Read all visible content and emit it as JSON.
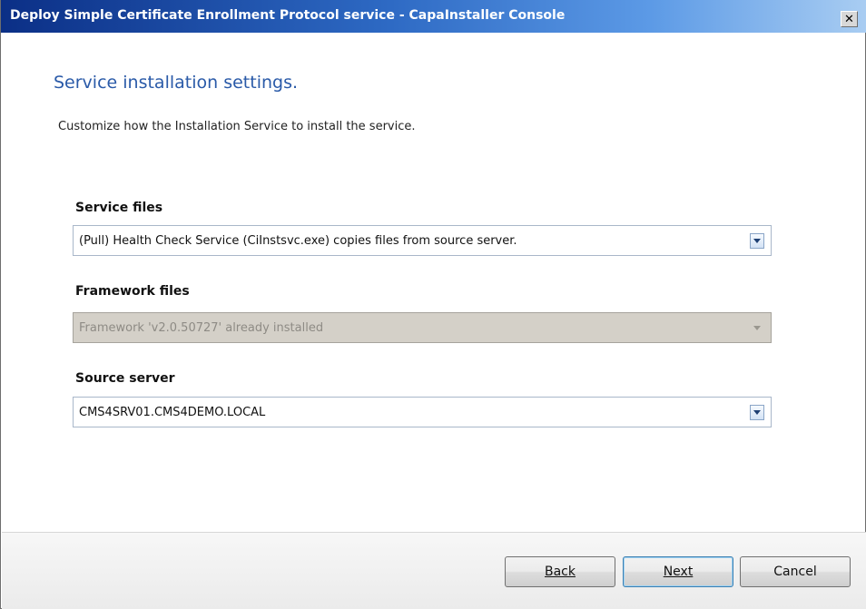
{
  "window": {
    "title": "Deploy Simple Certificate Enrollment Protocol service - CapaInstaller Console",
    "close_glyph": "✕"
  },
  "page": {
    "heading": "Service installation settings.",
    "subtitle": "Customize how the Installation Service to install the  service."
  },
  "fields": {
    "service_files": {
      "label": "Service files",
      "value": "(Pull) Health Check Service (CiInstsvc.exe) copies files from source server."
    },
    "framework_files": {
      "label": "Framework files",
      "value": "Framework 'v2.0.50727' already installed"
    },
    "source_server": {
      "label": "Source server",
      "value": "CMS4SRV01.CMS4DEMO.LOCAL"
    }
  },
  "buttons": {
    "back": "Back",
    "next": "Next",
    "cancel": "Cancel"
  },
  "colors": {
    "title_gradient_start": "#0b2f86",
    "title_gradient_end": "#a9cdf2",
    "heading": "#2a5aa8",
    "disabled_field": "#d4d0c8"
  },
  "icons": {
    "close": "close-icon",
    "dropdown": "chevron-down-icon"
  }
}
